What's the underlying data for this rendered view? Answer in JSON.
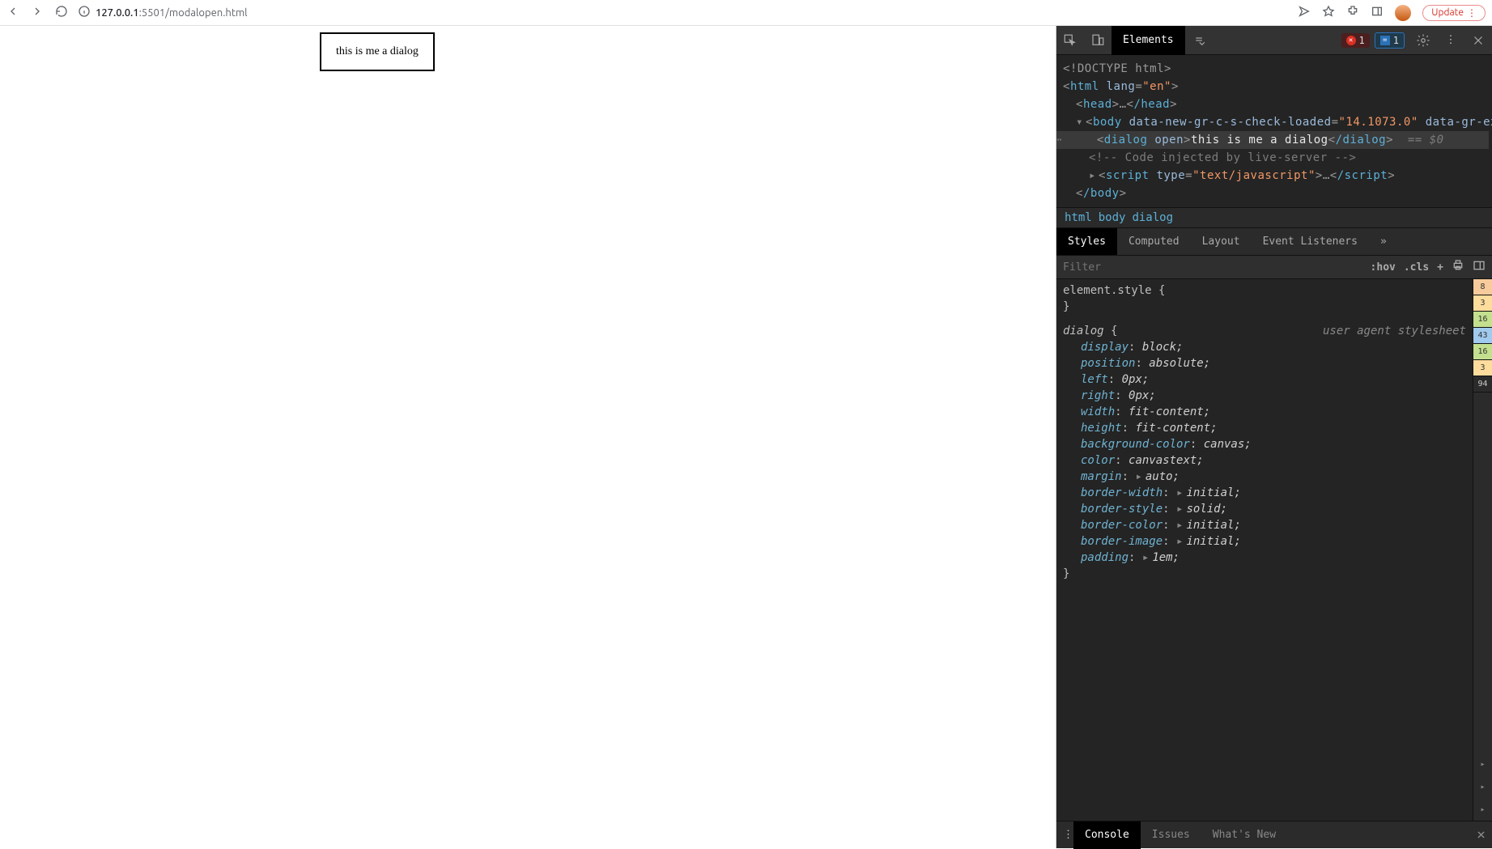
{
  "browser": {
    "url_domain": "127.0.0.1",
    "url_port_path": ":5501/modalopen.html",
    "update_label": "Update"
  },
  "page": {
    "dialog_text": "this is me a dialog"
  },
  "devtools": {
    "header": {
      "tab_elements": "Elements",
      "errors_count": "1",
      "info_count": "1"
    },
    "dom": {
      "doctype": "<!DOCTYPE html>",
      "html_open": "html",
      "html_lang_attr": "lang",
      "html_lang_val": "\"en\"",
      "head_open": "head",
      "head_close": "/head",
      "body_open": "body",
      "body_attr1_name": "data-new-gr-c-s-check-loaded",
      "body_attr1_val": "\"14.1073.0\"",
      "body_attr2_name": "data-gr-ext-installed",
      "dialog_tag": "dialog",
      "dialog_attr": "open",
      "dialog_text": "this is me a dialog",
      "dialog_close": "/dialog",
      "sel_marker": "== $0",
      "comment": "<!-- Code injected by live-server -->",
      "script_tag": "script",
      "script_type_attr": "type",
      "script_type_val": "\"text/javascript\"",
      "script_close": "/script",
      "body_close": "/body"
    },
    "breadcrumb": [
      "html",
      "body",
      "dialog"
    ],
    "style_tabs": [
      "Styles",
      "Computed",
      "Layout",
      "Event Listeners"
    ],
    "style_toolbar": {
      "filter_placeholder": "Filter",
      "hov": ":hov",
      "cls": ".cls"
    },
    "rules": {
      "element_style_sel": "element.style",
      "ua_label": "user agent stylesheet",
      "dialog_sel": "dialog",
      "props": [
        {
          "name": "display",
          "value": "block"
        },
        {
          "name": "position",
          "value": "absolute"
        },
        {
          "name": "left",
          "value": "0px"
        },
        {
          "name": "right",
          "value": "0px"
        },
        {
          "name": "width",
          "value": "fit-content"
        },
        {
          "name": "height",
          "value": "fit-content"
        },
        {
          "name": "background-color",
          "value": "canvas"
        },
        {
          "name": "color",
          "value": "canvastext"
        },
        {
          "name": "margin",
          "value": "auto",
          "tri": true
        },
        {
          "name": "border-width",
          "value": "initial",
          "tri": true
        },
        {
          "name": "border-style",
          "value": "solid",
          "tri": true
        },
        {
          "name": "border-color",
          "value": "initial",
          "tri": true
        },
        {
          "name": "border-image",
          "value": "initial",
          "tri": true
        },
        {
          "name": "padding",
          "value": "1em",
          "tri": true
        }
      ]
    },
    "box_model_values": [
      "8",
      "3",
      "16",
      "43",
      "16",
      "3",
      "94"
    ],
    "drawer": {
      "console": "Console",
      "issues": "Issues",
      "whatsnew": "What's New"
    }
  }
}
